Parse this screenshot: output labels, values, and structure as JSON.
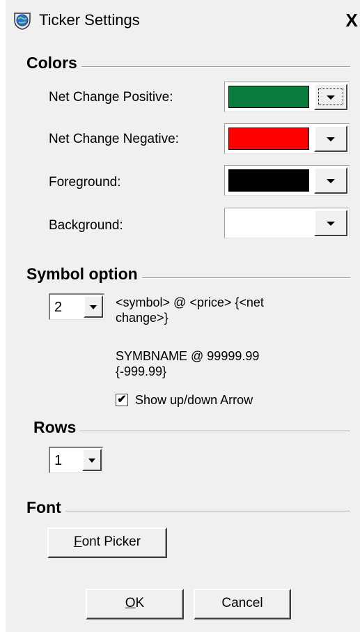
{
  "window": {
    "title": "Ticker Settings",
    "close_glyph": "X",
    "icon": "app-globe-icon"
  },
  "colors": {
    "title": "Colors",
    "rows": [
      {
        "label": "Net Change Positive:",
        "color": "#0a7d3e"
      },
      {
        "label": "Net Change Negative:",
        "color": "#ff0000"
      },
      {
        "label": "Foreground:",
        "color": "#000000"
      },
      {
        "label": "Background:",
        "color": "#ffffff"
      }
    ]
  },
  "symbol_option": {
    "title": "Symbol option",
    "selected": "2",
    "format": "<symbol> @ <price> {<net change>}",
    "example": "SYMBNAME @ 99999.99 {-999.99}",
    "show_arrow_label": "Show up/down Arrow",
    "show_arrow_checked": true,
    "check_glyph": "✔"
  },
  "rows_section": {
    "title": "Rows",
    "selected": "1"
  },
  "font": {
    "title": "Font",
    "picker_mnemonic": "F",
    "picker_rest": "ont Picker"
  },
  "buttons": {
    "ok_mnemonic": "O",
    "ok_rest": "K",
    "cancel": "Cancel"
  }
}
